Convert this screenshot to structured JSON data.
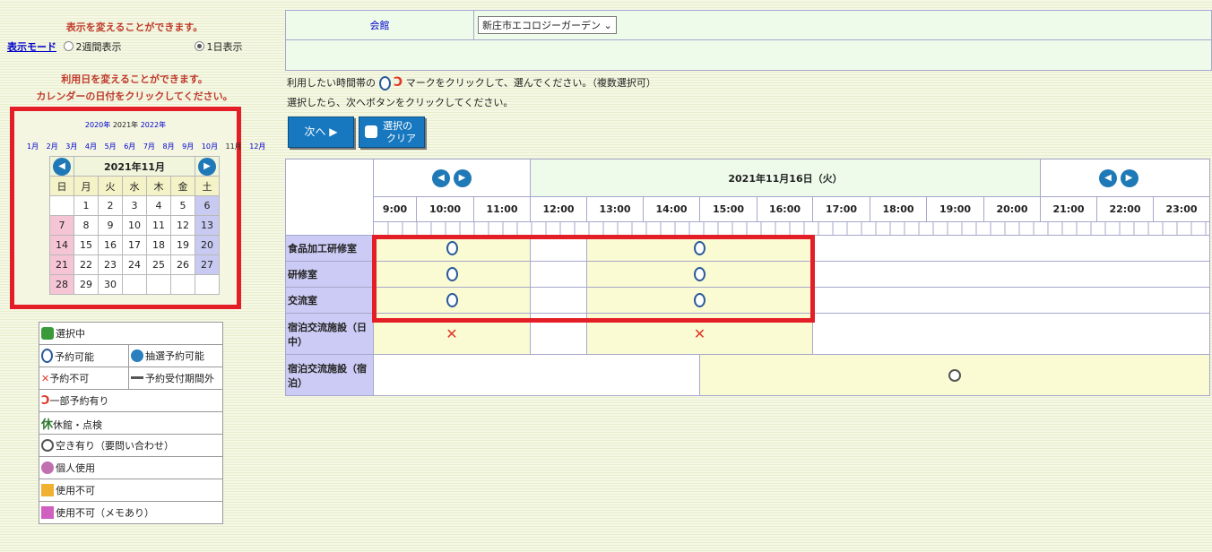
{
  "left": {
    "notice_mode": "表示を変えることができます。",
    "mode_label": "表示モード",
    "mode_2week": "2週間表示",
    "mode_1day": "1日表示",
    "notice_date1": "利用日を変えることができます。",
    "notice_date2": "カレンダーの日付をクリックしてください。",
    "calendar": {
      "prev_year": "2020年",
      "cur_year": "2021年",
      "next_year": "2022年",
      "months": [
        "1月",
        "2月",
        "3月",
        "4月",
        "5月",
        "6月",
        "7月",
        "8月",
        "9月",
        "10月",
        "11月",
        "12月"
      ],
      "title": "2021年11月",
      "weekdays": [
        "日",
        "月",
        "火",
        "水",
        "木",
        "金",
        "土"
      ],
      "weeks": [
        [
          "",
          "1",
          "2",
          "3",
          "4",
          "5",
          "6"
        ],
        [
          "7",
          "8",
          "9",
          "10",
          "11",
          "12",
          "13"
        ],
        [
          "14",
          "15",
          "16",
          "17",
          "18",
          "19",
          "20"
        ],
        [
          "21",
          "22",
          "23",
          "24",
          "25",
          "26",
          "27"
        ],
        [
          "28",
          "29",
          "30",
          "",
          "",
          "",
          ""
        ]
      ]
    },
    "legend": {
      "selected": "選択中",
      "available": "予約可能",
      "lottery": "抽選予約可能",
      "unavailable": "予約不可",
      "out_of_period": "予約受付期間外",
      "partial": "一部予約有り",
      "closed": "休館・点検",
      "inquire": "空き有り（要問い合わせ）",
      "personal": "個人使用",
      "not_usable": "使用不可",
      "not_usable_memo": "使用不可（メモあり）"
    }
  },
  "right": {
    "facility_label": "会館",
    "facility_value": "新庄市エコロジーガーデン",
    "instr1a": "利用したい時間帯の",
    "instr1b": "マークをクリックして、選んでください。（複数選択可）",
    "instr2": "選択したら、次へボタンをクリックしてください。",
    "btn_next": "次へ",
    "btn_clear1": "選択の",
    "btn_clear2": "クリア",
    "date_title": "2021年11月16日（火）",
    "times": [
      "9:00",
      "10:00",
      "11:00",
      "12:00",
      "13:00",
      "14:00",
      "15:00",
      "16:00",
      "17:00",
      "18:00",
      "19:00",
      "20:00",
      "21:00",
      "22:00",
      "23:00"
    ],
    "rooms": [
      "食品加工研修室",
      "研修室",
      "交流室",
      "宿泊交流施設（日中）",
      "宿泊交流施設（宿泊）"
    ]
  },
  "colors": {
    "highlight": "#e41e26",
    "room_header": "#cbcbf5",
    "slot_yellow": "#fbfbd3",
    "nav_blue": "#1f79b6"
  }
}
